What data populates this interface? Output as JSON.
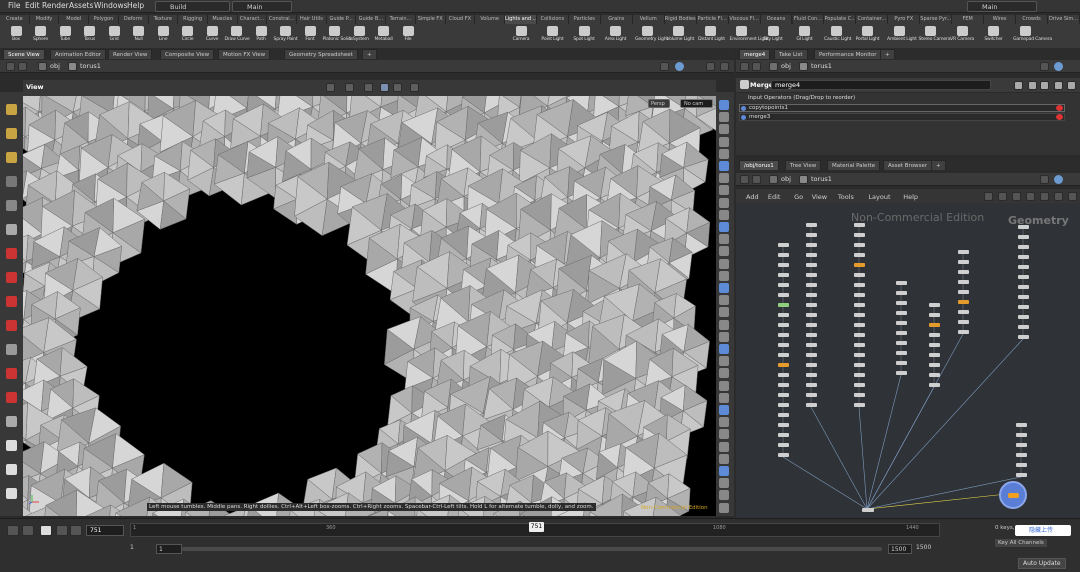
{
  "menu": {
    "items": [
      "File",
      "Edit",
      "Render",
      "Assets",
      "Windows",
      "Help"
    ],
    "desktop_build": "Build",
    "desktop_main": "Main",
    "desktop_right": "Main"
  },
  "shelf_tabs_left": [
    "Create",
    "Modify",
    "Model",
    "Polygon",
    "Deform",
    "Texture",
    "Rigging",
    "Muscles",
    "Charact...",
    "Constrai...",
    "Hair Utils",
    "Guide P...",
    "Guide B...",
    "Terrain...",
    "Simple FX",
    "Cloud FX",
    "Volume"
  ],
  "shelf_tabs_right": [
    "Lights and ...",
    "Collisions",
    "Particles",
    "Grains",
    "Vellum",
    "Rigid Bodies",
    "Particle Fl...",
    "Viscous Fl...",
    "Oceans",
    "Fluid Con...",
    "Populate C...",
    "Container...",
    "Pyro FX",
    "Sparse Pyr...",
    "FEM",
    "Wires",
    "Crowds",
    "Drive Sim..."
  ],
  "tools_left": [
    {
      "label": "Box",
      "icon": "box-icon"
    },
    {
      "label": "Sphere",
      "icon": "sphere-icon"
    },
    {
      "label": "Tube",
      "icon": "tube-icon"
    },
    {
      "label": "Torus",
      "icon": "torus-icon"
    },
    {
      "label": "Grid",
      "icon": "grid-icon"
    },
    {
      "label": "Null",
      "icon": "null-icon"
    },
    {
      "label": "Line",
      "icon": "line-icon"
    },
    {
      "label": "Circle",
      "icon": "circle-icon"
    },
    {
      "label": "Curve",
      "icon": "curve-icon"
    },
    {
      "label": "Draw Curve",
      "icon": "draw-curve-icon"
    },
    {
      "label": "Path",
      "icon": "path-icon"
    },
    {
      "label": "Spray Paint",
      "icon": "spray-paint-icon"
    },
    {
      "label": "Font",
      "icon": "font-icon"
    },
    {
      "label": "Platonic Solids",
      "icon": "platonic-icon"
    },
    {
      "label": "L-System",
      "icon": "lsystem-icon"
    },
    {
      "label": "Metaball",
      "icon": "metaball-icon"
    },
    {
      "label": "File",
      "icon": "file-icon"
    }
  ],
  "tools_right": [
    {
      "label": "Camera",
      "icon": "camera-icon"
    },
    {
      "label": "Point Light",
      "icon": "point-light-icon"
    },
    {
      "label": "Spot Light",
      "icon": "spot-light-icon"
    },
    {
      "label": "Area Light",
      "icon": "area-light-icon"
    },
    {
      "label": "Geometry Light",
      "icon": "geometry-light-icon"
    },
    {
      "label": "Volume Light",
      "icon": "volume-light-icon"
    },
    {
      "label": "Distant Light",
      "icon": "distant-light-icon"
    },
    {
      "label": "Environment Light",
      "icon": "environment-light-icon"
    },
    {
      "label": "Sky Light",
      "icon": "sky-light-icon"
    },
    {
      "label": "GI Light",
      "icon": "gi-light-icon"
    },
    {
      "label": "Caustic Light",
      "icon": "caustic-light-icon"
    },
    {
      "label": "Portal Light",
      "icon": "portal-light-icon"
    },
    {
      "label": "Ambient Light",
      "icon": "ambient-light-icon"
    },
    {
      "label": "Stereo Camera",
      "icon": "stereo-camera-icon"
    },
    {
      "label": "VR Camera",
      "icon": "vr-camera-icon"
    },
    {
      "label": "Switcher",
      "icon": "switcher-icon"
    },
    {
      "label": "Gamepad Camera",
      "icon": "gamepad-camera-icon"
    }
  ],
  "left_pane_tabs": [
    "Scene View",
    "Animation Editor",
    "Render View",
    "Composite View",
    "Motion FX View",
    "Geometry Spreadsheet"
  ],
  "path_obj": "obj",
  "path_node": "torus1",
  "viewport": {
    "title": "View",
    "persp": "Persp",
    "cam": "No cam",
    "status": "Left mouse tumbles. Middle pans. Right dollies. Ctrl+Alt+Left box-zooms. Ctrl+Right zooms. Spacebar-Ctrl-Left tilts. Hold L for alternate tumble, dolly, and zoom.",
    "watermark": "Non-Commercial Edition"
  },
  "param": {
    "tabs": [
      "merge4",
      "Take List",
      "Performance Monitor"
    ],
    "obj": "obj",
    "node": "torus1",
    "type": "Merge",
    "name": "merge4",
    "section": "Input Operators (Drag/Drop to reorder)",
    "inputs": [
      "copytopoints1",
      "merge3"
    ]
  },
  "network": {
    "tabs": [
      "/obj/torus1",
      "Tree View",
      "Material Palette",
      "Asset Browser"
    ],
    "obj": "obj",
    "node": "torus1",
    "menu": [
      "Add",
      "Edit",
      "Go",
      "View",
      "Tools",
      "Layout",
      "Help"
    ],
    "watermark": "Non-Commercial Edition",
    "type_wm": "Geometry"
  },
  "timeline": {
    "frame": "751",
    "marker": "751",
    "ticks": [
      "1",
      "360",
      "1080",
      "1440"
    ],
    "start": "1",
    "start2": "1",
    "end": "1500",
    "end2": "1500",
    "keys": "0 keys, 0/0 channels",
    "keyall": "Key All Channels",
    "autoupdate": "Auto Update",
    "share": "隐藏上传"
  },
  "colors": {
    "accent": "#e59a2c",
    "selected": "#5d8bd8",
    "bg": "#2b2b2b"
  }
}
